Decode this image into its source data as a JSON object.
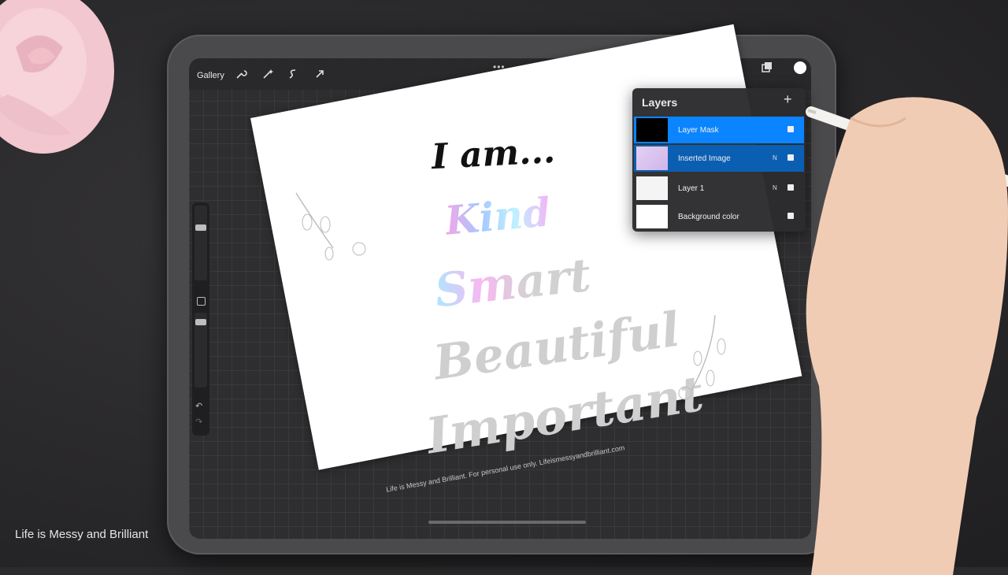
{
  "app": {
    "toolbar": {
      "gallery_label": "Gallery",
      "color_swatch": "#ffffff"
    },
    "layers_panel": {
      "title": "Layers",
      "add_label": "+",
      "layers": [
        {
          "name": "Layer Mask",
          "mode": "",
          "visible": true,
          "state": "selected"
        },
        {
          "name": "Inserted Image",
          "mode": "N",
          "visible": true,
          "state": "sub-selected"
        },
        {
          "name": "Layer 1",
          "mode": "N",
          "visible": true,
          "state": "normal"
        },
        {
          "name": "Background color",
          "mode": "",
          "visible": true,
          "state": "normal"
        }
      ]
    },
    "canvas": {
      "heading": "I am...",
      "words": [
        "Kind",
        "Smart",
        "Beautiful",
        "Important"
      ],
      "footer": "Life is Messy and Brilliant. For personal use only. Lifeismessyandbrilliant.com"
    }
  },
  "overlay": {
    "watermark": "Life is Messy and Brilliant"
  },
  "colors": {
    "accent": "#0a84ff",
    "sub_selected": "#0b5fb2",
    "panel": "#2c2c2e"
  }
}
